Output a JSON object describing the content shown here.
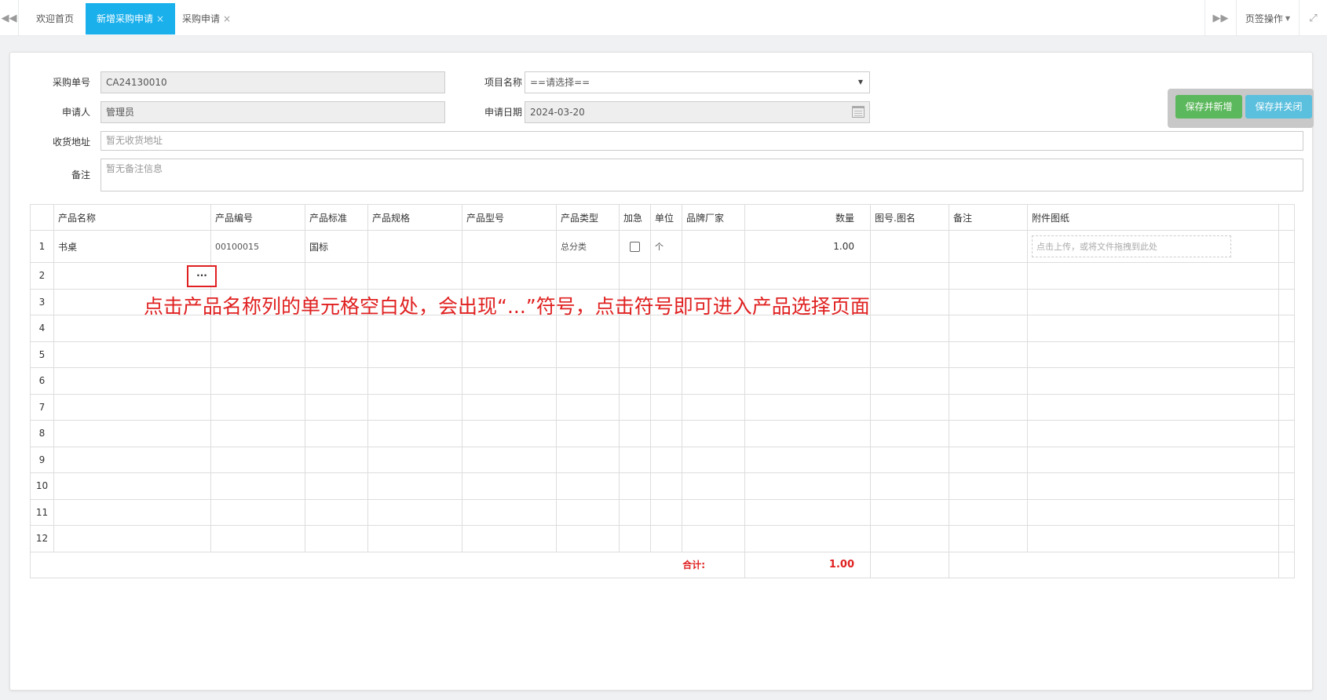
{
  "tabs": [
    {
      "label": "欢迎首页",
      "active": false,
      "closable": false
    },
    {
      "label": "新增采购申请",
      "active": true,
      "closable": true
    },
    {
      "label": "采购申请",
      "active": false,
      "closable": true
    }
  ],
  "tab_close_glyph": "×",
  "tab_ops_label": "页签操作",
  "buttons": {
    "save_new": "保存并新增",
    "save_close": "保存并关闭"
  },
  "form": {
    "order_no_label": "采购单号",
    "order_no_value": "CA24130010",
    "project_label": "项目名称",
    "project_value": "==请选择==",
    "applicant_label": "申请人",
    "applicant_value": "管理员",
    "date_label": "申请日期",
    "date_value": "2024-03-20",
    "address_label": "收货地址",
    "address_placeholder": "暂无收货地址",
    "remark_label": "备注",
    "remark_placeholder": "暂无备注信息"
  },
  "grid": {
    "columns": [
      "",
      "产品名称",
      "产品编号",
      "产品标准",
      "产品规格",
      "产品型号",
      "产品类型",
      "加急",
      "单位",
      "品牌厂家",
      "数量",
      "图号.图名",
      "备注",
      "附件图纸"
    ],
    "rows": [
      {
        "num": "1",
        "name": "书桌",
        "code": "00100015",
        "standard": "国标",
        "type": "总分类",
        "urgent": false,
        "unit": "个",
        "qty": "1.00",
        "upload": "点击上传，或将文件拖拽到此处"
      },
      {
        "num": "2"
      },
      {
        "num": "3"
      },
      {
        "num": "4"
      },
      {
        "num": "5"
      },
      {
        "num": "6"
      },
      {
        "num": "7"
      },
      {
        "num": "8"
      },
      {
        "num": "9"
      },
      {
        "num": "10"
      },
      {
        "num": "11"
      },
      {
        "num": "12"
      }
    ],
    "total_label": "合计:",
    "total_value": "1.00"
  },
  "ellipsis": "···",
  "annotation": "点击产品名称列的单元格空白处，会出现“...”符号，点击符号即可进入产品选择页面",
  "colors": {
    "tab_active": "#1ab0ec",
    "save_new": "#5cb85c",
    "save_close": "#5bc0de",
    "annotation": "#e02020"
  }
}
